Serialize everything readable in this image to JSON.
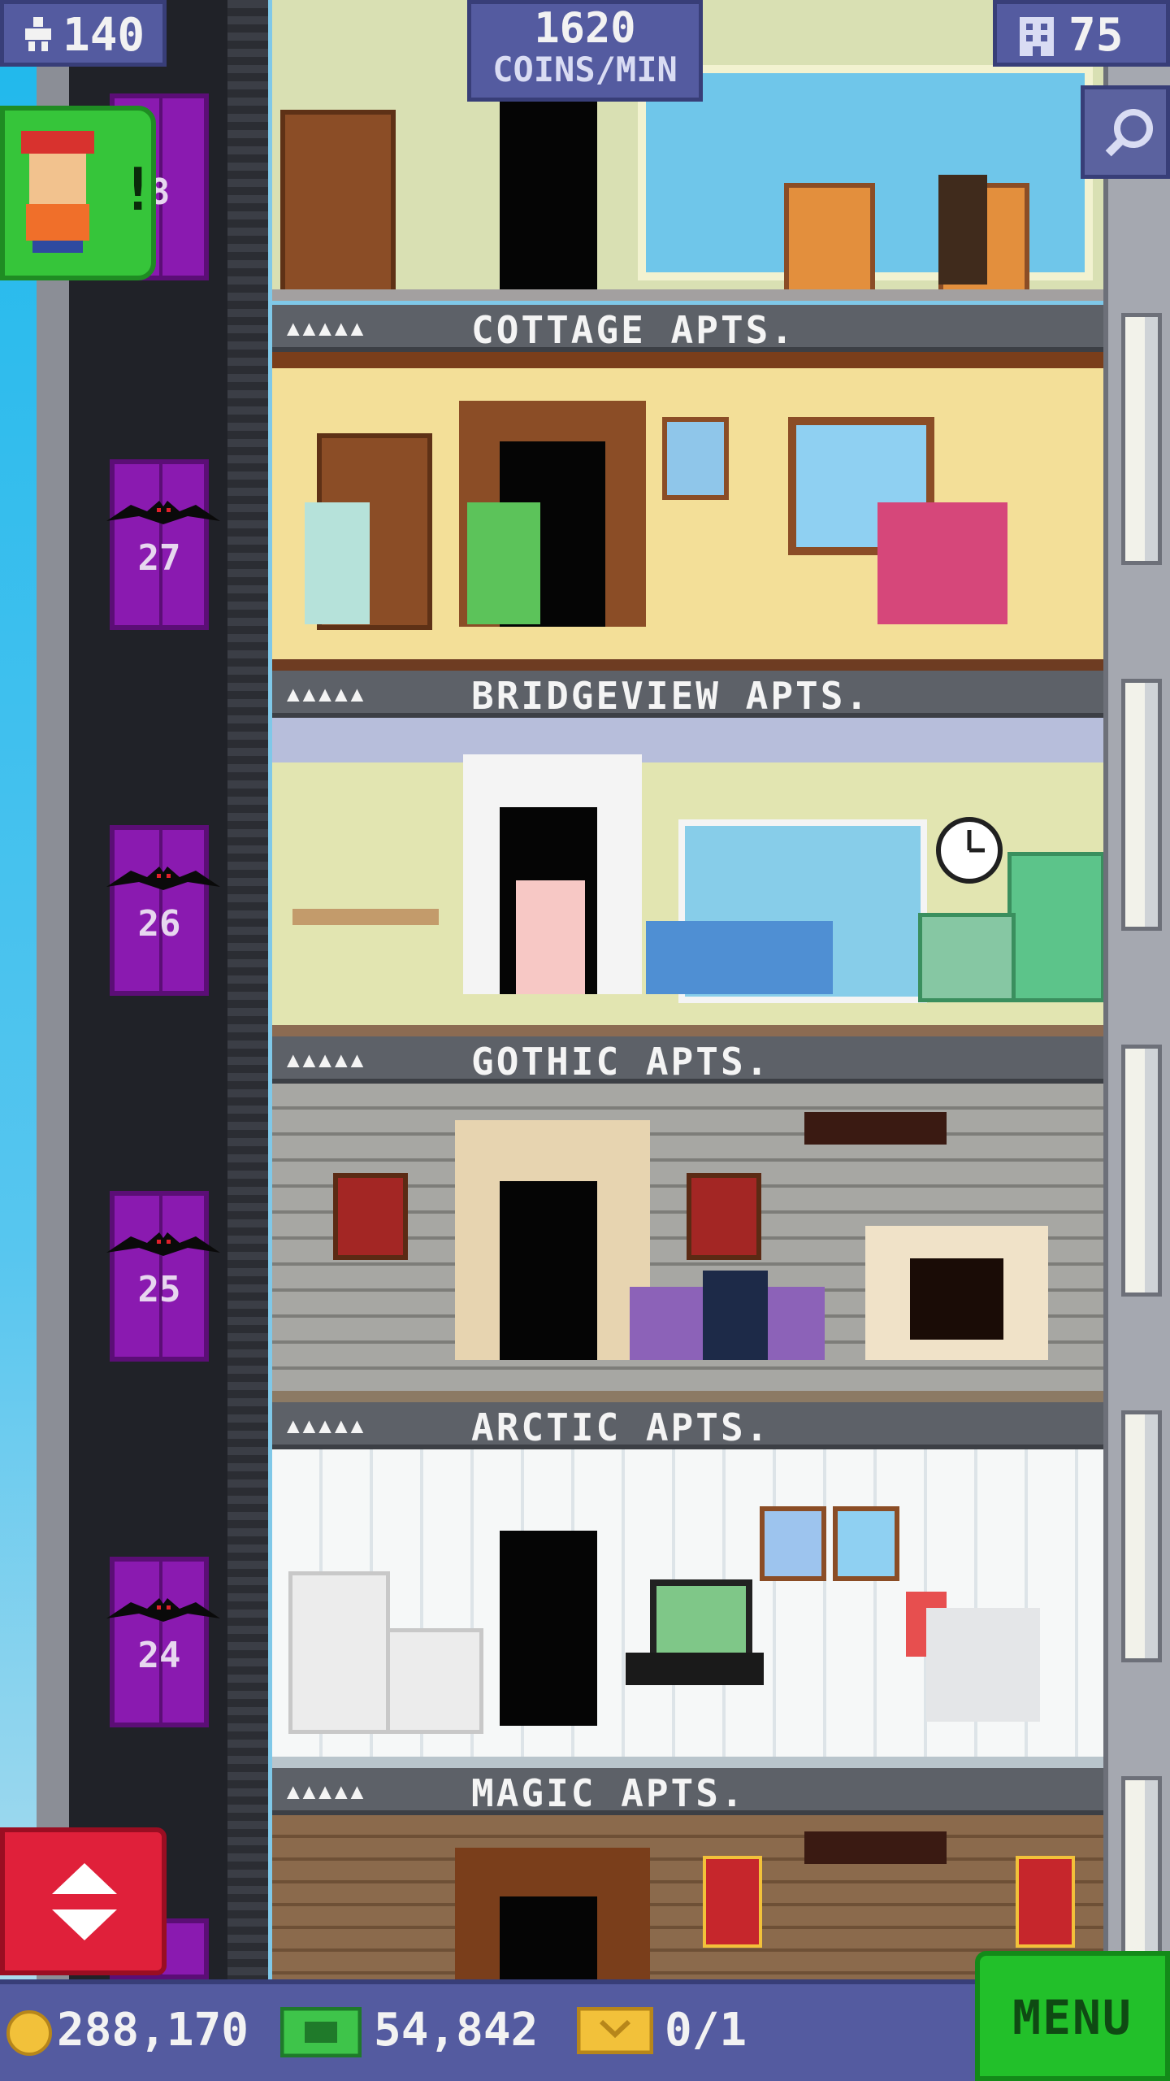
{
  "hud": {
    "population": "140",
    "coins_rate_value": "1620",
    "coins_rate_unit": "COINS/MIN",
    "floors_count": "75"
  },
  "vip_alert": {
    "symbol": "!"
  },
  "top_floor": {
    "elevator_number": "8"
  },
  "floors": [
    {
      "name": "COTTAGE APTS.",
      "stars": "▲▲▲▲▲",
      "elevator_number": "27"
    },
    {
      "name": "BRIDGEVIEW APTS.",
      "stars": "▲▲▲▲▲",
      "elevator_number": "26"
    },
    {
      "name": "GOTHIC APTS.",
      "stars": "▲▲▲▲▲",
      "elevator_number": "25"
    },
    {
      "name": "ARCTIC APTS.",
      "stars": "▲▲▲▲▲",
      "elevator_number": "24"
    },
    {
      "name": "MAGIC APTS.",
      "stars": "▲▲▲▲▲",
      "elevator_number": ""
    }
  ],
  "bottom_bar": {
    "coins": "288,170",
    "bux": "54,842",
    "tickets": "0/1",
    "menu_label": "MENU"
  },
  "colors": {
    "hud": "#545ba0",
    "menu": "#22c02a",
    "elevator_button": "#e0203a",
    "elevator_car": "#8a1ab0"
  },
  "icons": [
    "population-icon",
    "floors-icon",
    "search-icon",
    "coin-icon",
    "bux-icon",
    "ticket-icon",
    "elevator-arrows-icon",
    "bat-icon"
  ]
}
